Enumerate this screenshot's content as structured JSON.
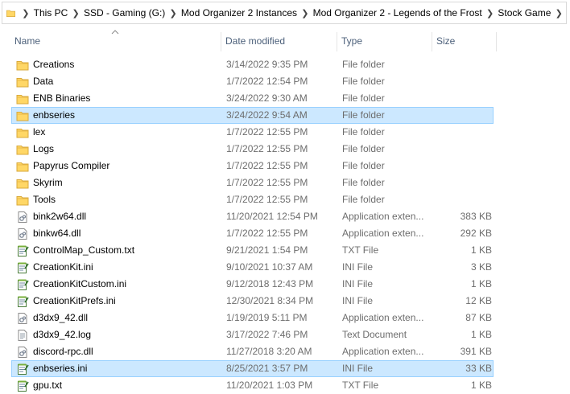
{
  "address": {
    "crumbs": [
      "This PC",
      "SSD - Gaming (G:)",
      "Mod Organizer 2 Instances",
      "Mod Organizer 2 - Legends of the Frost",
      "Stock Game"
    ]
  },
  "columns": {
    "name": "Name",
    "date": "Date modified",
    "type": "Type",
    "size": "Size"
  },
  "colors": {
    "selected_bg": "#cce8ff",
    "selected_border": "#99d1ff",
    "header_text": "#4c607a",
    "folder_yellow": "#ffd766"
  },
  "files": [
    {
      "name": "Creations",
      "date": "3/14/2022 9:35 PM",
      "type": "File folder",
      "size": "",
      "icon": "folder-icon",
      "selected": false
    },
    {
      "name": "Data",
      "date": "1/7/2022 12:54 PM",
      "type": "File folder",
      "size": "",
      "icon": "folder-icon",
      "selected": false
    },
    {
      "name": "ENB Binaries",
      "date": "3/24/2022 9:30 AM",
      "type": "File folder",
      "size": "",
      "icon": "folder-icon",
      "selected": false
    },
    {
      "name": "enbseries",
      "date": "3/24/2022 9:54 AM",
      "type": "File folder",
      "size": "",
      "icon": "folder-icon",
      "selected": true
    },
    {
      "name": "lex",
      "date": "1/7/2022 12:55 PM",
      "type": "File folder",
      "size": "",
      "icon": "folder-icon",
      "selected": false
    },
    {
      "name": "Logs",
      "date": "1/7/2022 12:55 PM",
      "type": "File folder",
      "size": "",
      "icon": "folder-icon",
      "selected": false
    },
    {
      "name": "Papyrus Compiler",
      "date": "1/7/2022 12:55 PM",
      "type": "File folder",
      "size": "",
      "icon": "folder-icon",
      "selected": false
    },
    {
      "name": "Skyrim",
      "date": "1/7/2022 12:55 PM",
      "type": "File folder",
      "size": "",
      "icon": "folder-icon",
      "selected": false
    },
    {
      "name": "Tools",
      "date": "1/7/2022 12:55 PM",
      "type": "File folder",
      "size": "",
      "icon": "folder-icon",
      "selected": false
    },
    {
      "name": "bink2w64.dll",
      "date": "11/20/2021 12:54 PM",
      "type": "Application exten...",
      "size": "383 KB",
      "icon": "dll-icon",
      "selected": false
    },
    {
      "name": "binkw64.dll",
      "date": "1/7/2022 12:55 PM",
      "type": "Application exten...",
      "size": "292 KB",
      "icon": "dll-icon",
      "selected": false
    },
    {
      "name": "ControlMap_Custom.txt",
      "date": "9/21/2021 1:54 PM",
      "type": "TXT File",
      "size": "1 KB",
      "icon": "notepad-icon",
      "selected": false
    },
    {
      "name": "CreationKit.ini",
      "date": "9/10/2021 10:37 AM",
      "type": "INI File",
      "size": "3 KB",
      "icon": "notepad-icon",
      "selected": false
    },
    {
      "name": "CreationKitCustom.ini",
      "date": "9/12/2018 12:43 PM",
      "type": "INI File",
      "size": "1 KB",
      "icon": "notepad-icon",
      "selected": false
    },
    {
      "name": "CreationKitPrefs.ini",
      "date": "12/30/2021 8:34 PM",
      "type": "INI File",
      "size": "12 KB",
      "icon": "notepad-icon",
      "selected": false
    },
    {
      "name": "d3dx9_42.dll",
      "date": "1/19/2019 5:11 PM",
      "type": "Application exten...",
      "size": "87 KB",
      "icon": "dll-icon",
      "selected": false
    },
    {
      "name": "d3dx9_42.log",
      "date": "3/17/2022 7:46 PM",
      "type": "Text Document",
      "size": "1 KB",
      "icon": "document-icon",
      "selected": false
    },
    {
      "name": "discord-rpc.dll",
      "date": "11/27/2018 3:20 AM",
      "type": "Application exten...",
      "size": "391 KB",
      "icon": "dll-icon",
      "selected": false
    },
    {
      "name": "enbseries.ini",
      "date": "8/25/2021 3:57 PM",
      "type": "INI File",
      "size": "33 KB",
      "icon": "notepad-icon",
      "selected": true
    },
    {
      "name": "gpu.txt",
      "date": "11/20/2021 1:03 PM",
      "type": "TXT File",
      "size": "1 KB",
      "icon": "notepad-icon",
      "selected": false
    }
  ]
}
